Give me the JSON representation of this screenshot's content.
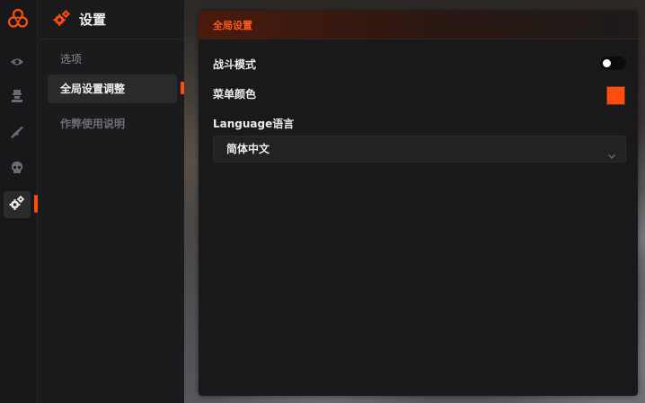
{
  "colors": {
    "accent": "#ff4d0d",
    "menu_color": "#ff4d0d"
  },
  "rail": {
    "logo_icon": "biohazard-icon",
    "items": [
      {
        "icon": "eye-icon",
        "active": false
      },
      {
        "icon": "soldier-icon",
        "active": false
      },
      {
        "icon": "rifle-icon",
        "active": false
      },
      {
        "icon": "skull-icon",
        "active": false
      },
      {
        "icon": "gears-icon",
        "active": true
      }
    ]
  },
  "subnav": {
    "title": "设置",
    "section_label": "选项",
    "items": [
      {
        "label": "全局设置调整",
        "active": true
      },
      {
        "label": "作弊使用说明",
        "active": false
      }
    ]
  },
  "panel": {
    "title": "全局设置",
    "battle_mode": {
      "label": "战斗模式",
      "enabled": false
    },
    "menu_color": {
      "label": "菜单颜色"
    },
    "language": {
      "label": "Language语言",
      "selected": "简体中文"
    }
  }
}
